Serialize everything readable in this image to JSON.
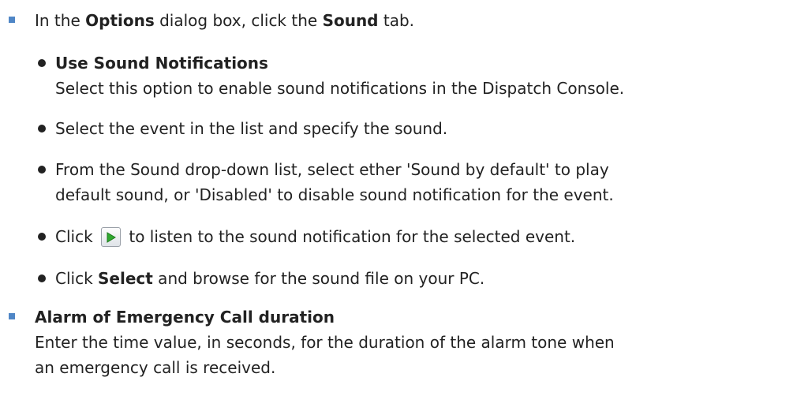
{
  "items": [
    {
      "prefix": "In the ",
      "options_bold": "Options",
      "middle": " dialog box, click the ",
      "sound_bold": "Sound",
      "suffix": " tab."
    },
    {
      "title": "Use Sound Notifications",
      "description": "Select this option to enable sound notifications in the Dispatch Console."
    },
    {
      "text": "Select the event in the list and specify the sound."
    },
    {
      "line1": "From the Sound drop-down list, select ether 'Sound by default' to play",
      "line2": "default sound, or 'Disabled' to disable sound notification for the event."
    },
    {
      "prefix": "Click",
      "icon": "play-icon",
      "suffix": "to listen to the sound notification for the selected event."
    },
    {
      "prefix": "Click ",
      "bold": "Select",
      "suffix": " and browse for the sound file on your PC."
    },
    {
      "title": "Alarm of Emergency Call duration",
      "line1": "Enter the time value, in seconds, for the duration of the alarm tone when",
      "line2": "an emergency call is received."
    }
  ],
  "colors": {
    "square_bullet": "#4f86c6",
    "text": "#222222",
    "play_triangle": "#2fa82f"
  }
}
